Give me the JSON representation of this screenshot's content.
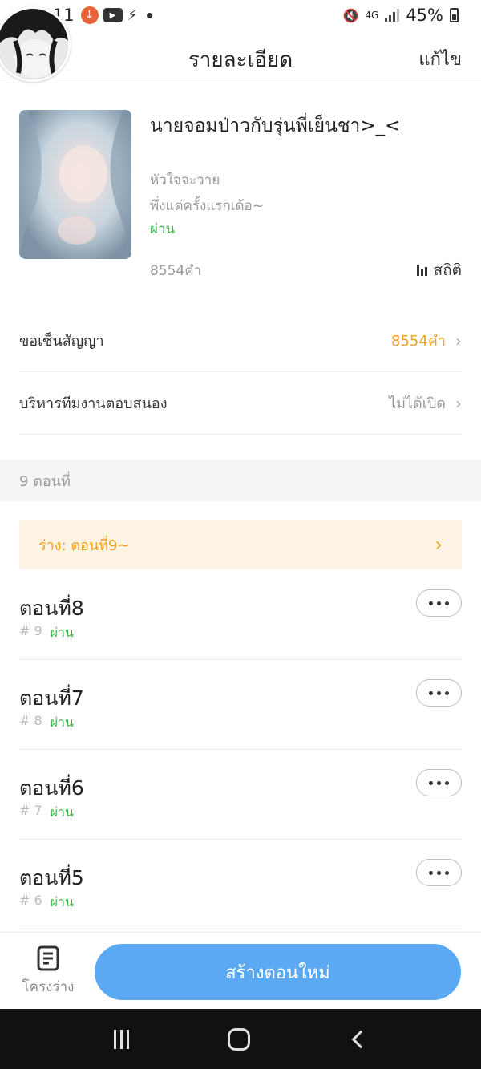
{
  "status_bar": {
    "time": "16:11",
    "network": "4G",
    "battery": "45%"
  },
  "header": {
    "title": "รายละเอียด",
    "edit_label": "แก้ไข"
  },
  "book": {
    "title": "นายจอมป่าวกับรุ่นพี่เย็นชา>_<",
    "line1": "หัวใจจะวาย",
    "line2": "พึ่งแต่ครั้งแรกเด้อ~",
    "status": "ผ่าน",
    "word_count": "8554คำ",
    "stats_label": "สถิติ"
  },
  "settings": {
    "contract_label": "ขอเซ็นสัญญา",
    "contract_value": "8554คำ",
    "team_label": "บริหารทีมงานตอบสนอง",
    "team_value": "ไม่ได้เปิด"
  },
  "chapters_header": "9 ตอนที่",
  "draft": {
    "label": "ร่าง: ตอนที่9~"
  },
  "chapters": [
    {
      "title": "ตอนที่8",
      "number": "# 9",
      "status": "ผ่าน"
    },
    {
      "title": "ตอนที่7",
      "number": "# 8",
      "status": "ผ่าน"
    },
    {
      "title": "ตอนที่6",
      "number": "# 7",
      "status": "ผ่าน"
    },
    {
      "title": "ตอนที่5",
      "number": "# 6",
      "status": "ผ่าน"
    }
  ],
  "bottom": {
    "outline_label": "โครงร่าง",
    "create_label": "สร้างตอนใหม่"
  },
  "colors": {
    "accent_blue": "#5aa9f2",
    "status_green": "#3cb54a",
    "orange": "#f0a021",
    "draft_bg": "#fff3e5"
  }
}
